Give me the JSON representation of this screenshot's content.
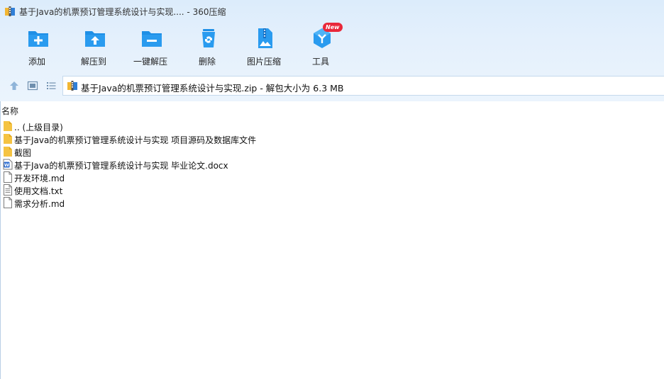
{
  "window": {
    "title": "基于Java的机票预订管理系统设计与实现.... - 360压缩"
  },
  "toolbar": {
    "add_label": "添加",
    "extract_to_label": "解压到",
    "one_click_extract_label": "一键解压",
    "delete_label": "删除",
    "image_compress_label": "图片压缩",
    "tools_label": "工具",
    "tools_badge": "New"
  },
  "path_bar": {
    "text": "基于Java的机票预订管理系统设计与实现.zip - 解包大小为 6.3 MB"
  },
  "list": {
    "column_name": "名称",
    "items": [
      {
        "name": ".. (上级目录)",
        "type": "folder"
      },
      {
        "name": "基于Java的机票预订管理系统设计与实现 项目源码及数据库文件",
        "type": "folder"
      },
      {
        "name": "截图",
        "type": "folder"
      },
      {
        "name": "基于Java的机票预订管理系统设计与实现 毕业论文.docx",
        "type": "docx"
      },
      {
        "name": "开发环境.md",
        "type": "file"
      },
      {
        "name": "使用文档.txt",
        "type": "txt"
      },
      {
        "name": "需求分析.md",
        "type": "file"
      }
    ]
  },
  "colors": {
    "accent": "#1e8fe6",
    "badge": "#e9283a",
    "folder": "#f5c342"
  }
}
